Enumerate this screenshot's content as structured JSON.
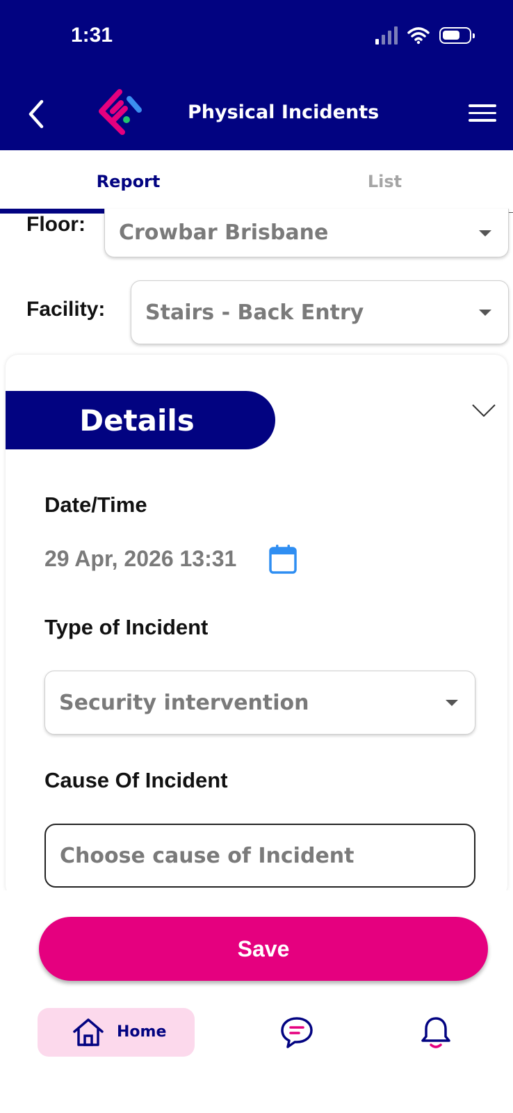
{
  "status_bar": {
    "time": "1:31"
  },
  "header": {
    "title": "Physical Incidents",
    "back_icon": "chevron-left-icon",
    "menu_icon": "hamburger-icon",
    "color": "#020381"
  },
  "tabs": [
    {
      "label": "Report",
      "active": true
    },
    {
      "label": "List",
      "active": false
    }
  ],
  "location": {
    "floor_label": "Floor:",
    "floor_value": "Crowbar Brisbane",
    "facility_label": "Facility:",
    "facility_value": "Stairs - Back Entry"
  },
  "details": {
    "title": "Details",
    "datetime_label": "Date/Time",
    "datetime_value": "29 Apr, 2026 13:31",
    "type_label": "Type of Incident",
    "type_value": "Security intervention",
    "cause_label": "Cause Of Incident",
    "cause_placeholder": "Choose cause of Incident"
  },
  "footer": {
    "save_label": "Save",
    "nav_home_label": "Home",
    "accent": "#e5007f"
  }
}
